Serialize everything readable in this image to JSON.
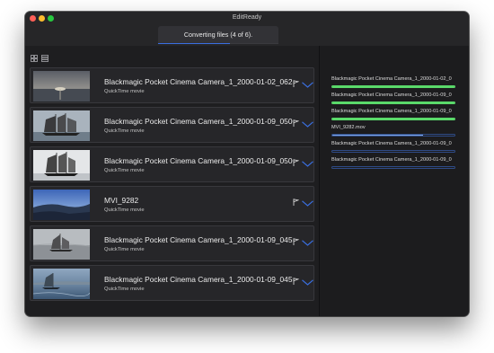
{
  "window": {
    "title": "EditReady",
    "status": {
      "text": "Converting files (4 of 6).",
      "progress_fraction": 0.6
    }
  },
  "colors": {
    "done": "#5ad96a",
    "active": "#7fa8ea",
    "accent": "#3a6fe0",
    "pending_border": "#2f4b86"
  },
  "toolbar": {
    "view_icons": [
      "grid-view-icon",
      "list-view-icon"
    ],
    "queue_icons": [
      "adjust-settings-icon",
      "sort-icon"
    ]
  },
  "clips": [
    {
      "name": "Blackmagic Pocket Cinema Camera_1_2000-01-02_0623...",
      "type": "QuickTime movie",
      "thumb": "sunset-sea"
    },
    {
      "name": "Blackmagic Pocket Cinema Camera_1_2000-01-09_0500...",
      "type": "QuickTime movie",
      "thumb": "tall-ship"
    },
    {
      "name": "Blackmagic Pocket Cinema Camera_1_2000-01-09_0500...",
      "type": "QuickTime movie",
      "thumb": "tall-ship-white"
    },
    {
      "name": "MVI_9282",
      "type": "QuickTime movie",
      "thumb": "coast-blue"
    },
    {
      "name": "Blackmagic Pocket Cinema Camera_1_2000-01-09_0457_...",
      "type": "QuickTime movie",
      "thumb": "sailboat-grey"
    },
    {
      "name": "Blackmagic Pocket Cinema Camera_1_2000-01-09_0459...",
      "type": "QuickTime movie",
      "thumb": "sailboat-sea"
    }
  ],
  "queue": [
    {
      "name": "Blackmagic Pocket Cinema Camera_1_2000-01-02_0",
      "state": "done",
      "progress": 1.0
    },
    {
      "name": "Blackmagic Pocket Cinema Camera_1_2000-01-09_0",
      "state": "done",
      "progress": 1.0
    },
    {
      "name": "Blackmagic Pocket Cinema Camera_1_2000-01-09_0",
      "state": "done",
      "progress": 1.0
    },
    {
      "name": "MVI_9282.mov",
      "state": "active",
      "progress": 0.74
    },
    {
      "name": "Blackmagic Pocket Cinema Camera_1_2000-01-09_0",
      "state": "pending",
      "progress": 0.0
    },
    {
      "name": "Blackmagic Pocket Cinema Camera_1_2000-01-09_0",
      "state": "pending",
      "progress": 0.0
    }
  ]
}
